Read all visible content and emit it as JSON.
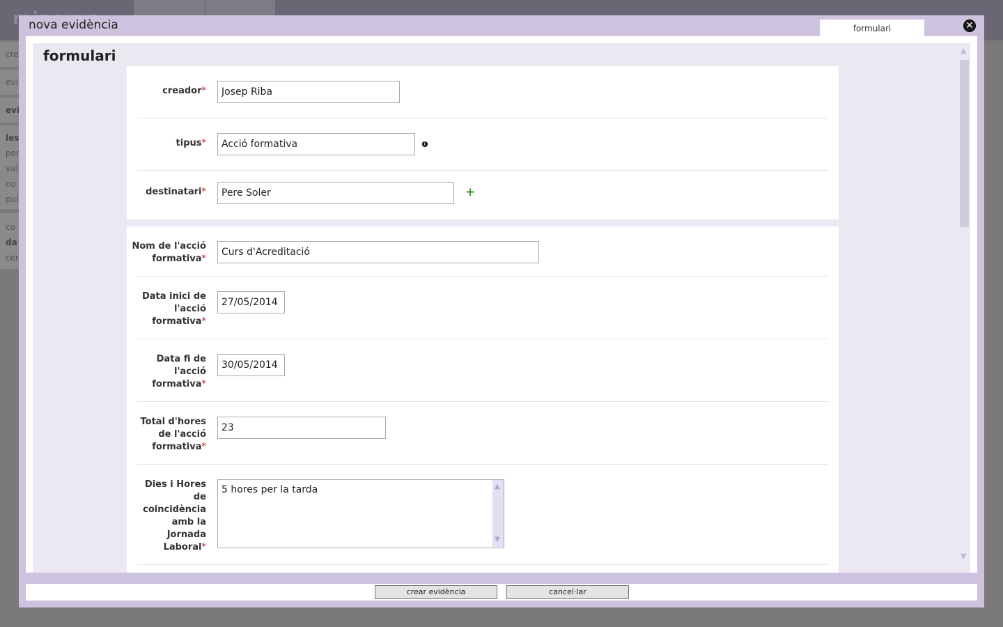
{
  "background": {
    "logo": "minerva",
    "sidebar_items": [
      "cre",
      "evi",
      "evi",
      "les",
      "per",
      "val",
      "no",
      "pul",
      "co",
      "da",
      "cer"
    ]
  },
  "dialog": {
    "title": "nova evidència",
    "tab_label": "formulari",
    "close_symbol": "✕"
  },
  "form": {
    "section_title": "formulari",
    "fields": {
      "creador": {
        "label": "creador",
        "value": "Josep Riba"
      },
      "tipus": {
        "label": "tipus",
        "value": "Acció formativa"
      },
      "destinatari": {
        "label": "destinatari",
        "value": "Pere Soler"
      },
      "nom_accio": {
        "label": "Nom de l'acció formativa",
        "value": "Curs d'Acreditació"
      },
      "data_inici": {
        "label": "Data inici de l'acció formativa",
        "value": "27/05/2014"
      },
      "data_fi": {
        "label": "Data fi de l'acció formativa",
        "value": "30/05/2014"
      },
      "total_hores": {
        "label": "Total d'hores de l'acció formativa",
        "value": "23"
      },
      "dies_hores": {
        "label": "Dies i Hores de coincidència amb la Jornada Laboral",
        "value": "5 hores per la tarda"
      }
    },
    "required_mark": "*"
  },
  "footer": {
    "create_label": "crear evidència",
    "cancel_label": "cancel·lar"
  },
  "icons": {
    "info": "info-icon",
    "add": "plus-icon",
    "close": "close-icon"
  },
  "colors": {
    "dialog_frame": "#cdc3de",
    "pane_background": "#ebe8f2",
    "required": "#cc1010",
    "add_green": "#3a9a28"
  }
}
